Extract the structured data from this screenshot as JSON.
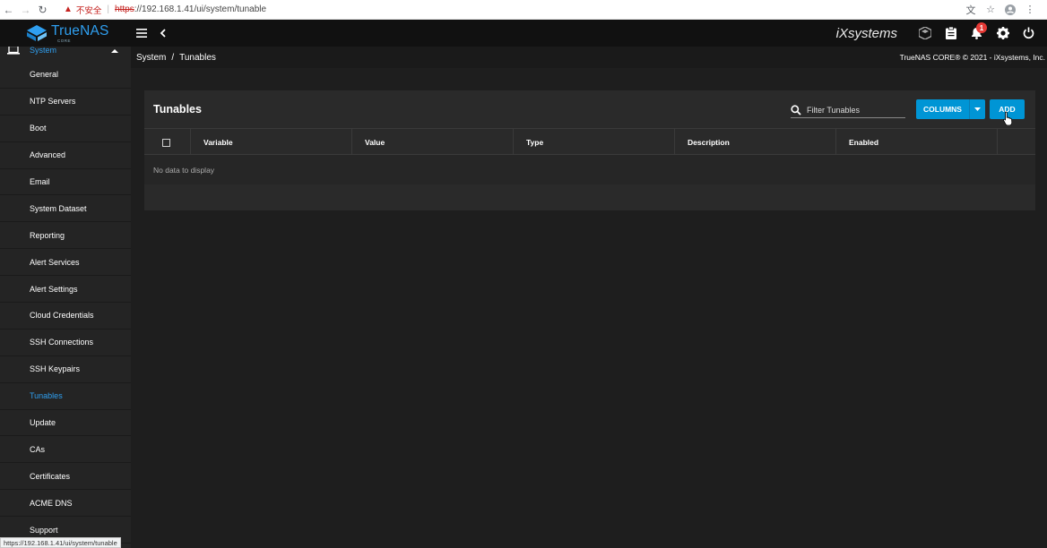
{
  "browser": {
    "security_label": "不安全",
    "url_scheme": "https",
    "url_rest": "://192.168.1.41/ui/system/tunable",
    "status_url": "https://192.168.1.41/ui/system/tunable"
  },
  "topbar": {
    "logo": "TrueNAS",
    "logo_sub": "CORE",
    "brand": "iXsystems",
    "notification_count": "1"
  },
  "sidebar": {
    "section_label": "System",
    "items": [
      {
        "label": "General"
      },
      {
        "label": "NTP Servers"
      },
      {
        "label": "Boot"
      },
      {
        "label": "Advanced"
      },
      {
        "label": "Email"
      },
      {
        "label": "System Dataset"
      },
      {
        "label": "Reporting"
      },
      {
        "label": "Alert Services"
      },
      {
        "label": "Alert Settings"
      },
      {
        "label": "Cloud Credentials"
      },
      {
        "label": "SSH Connections"
      },
      {
        "label": "SSH Keypairs"
      },
      {
        "label": "Tunables",
        "active": true
      },
      {
        "label": "Update"
      },
      {
        "label": "CAs"
      },
      {
        "label": "Certificates"
      },
      {
        "label": "ACME DNS"
      },
      {
        "label": "Support"
      }
    ]
  },
  "breadcrumb": {
    "parent": "System",
    "current": "Tunables",
    "copyright": "TrueNAS CORE® © 2021 - iXsystems, Inc."
  },
  "tunables": {
    "title": "Tunables",
    "filter_placeholder": "Filter Tunables",
    "columns_button": "COLUMNS",
    "add_button": "ADD",
    "columns": [
      "Variable",
      "Value",
      "Type",
      "Description",
      "Enabled"
    ],
    "empty_message": "No data to display"
  },
  "colors": {
    "accent": "#0095d5",
    "link_blue": "#2f9ff0",
    "background": "#1e1e1e",
    "card": "#2a2a2a"
  }
}
